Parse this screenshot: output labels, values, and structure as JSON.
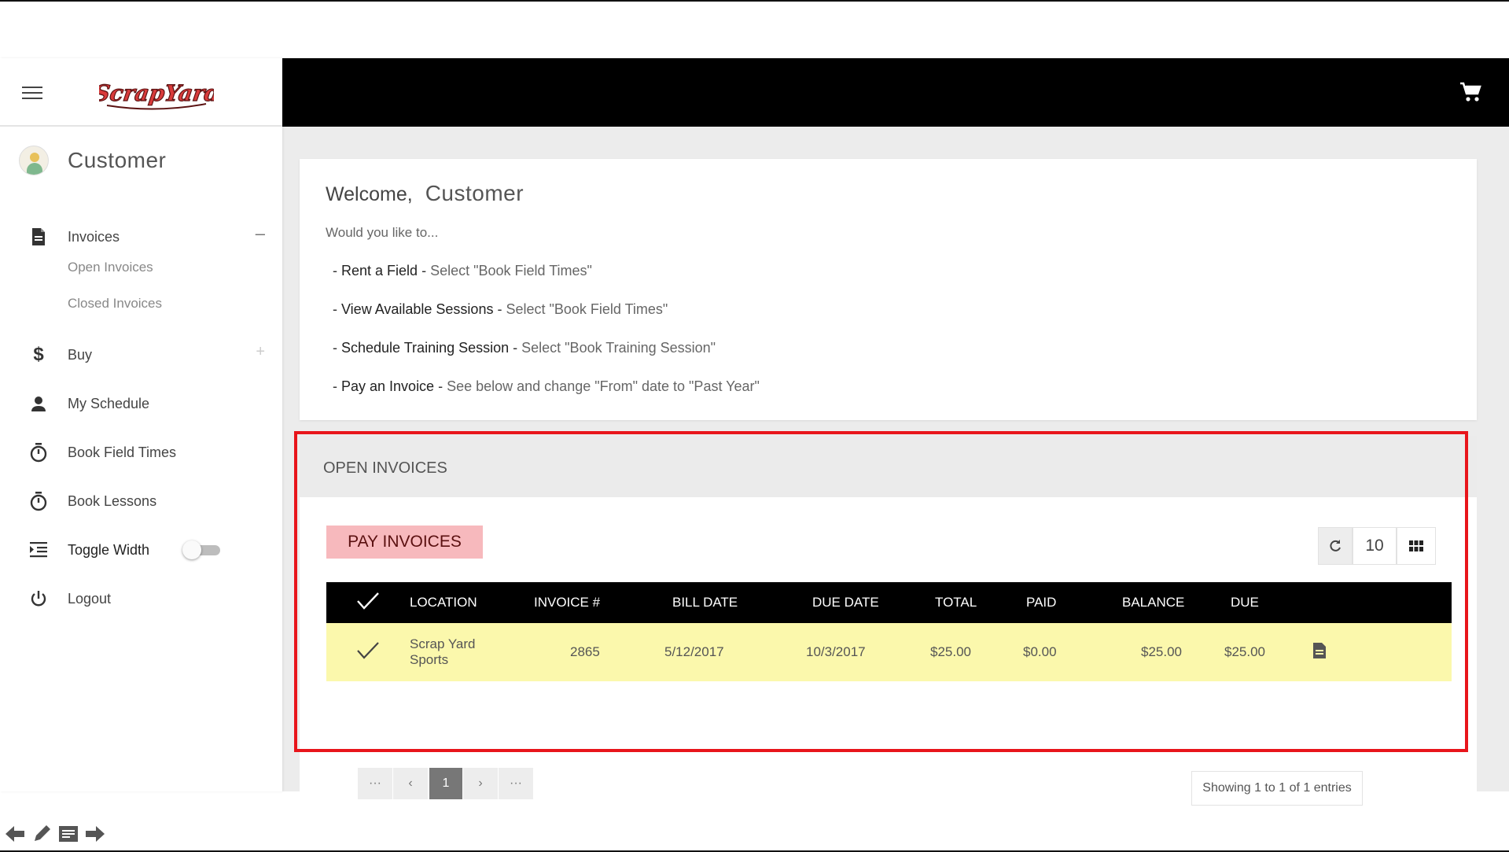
{
  "sidebar": {
    "logo_text": "ScrapYard",
    "user_name": "Customer",
    "items": [
      {
        "label": "Invoices",
        "icon": "document-icon",
        "state": "–"
      },
      {
        "label": "Open Invoices"
      },
      {
        "label": "Closed Invoices"
      },
      {
        "label": "Buy",
        "icon": "dollar-icon",
        "state": "+"
      },
      {
        "label": "My Schedule",
        "icon": "person-icon"
      },
      {
        "label": "Book Field Times",
        "icon": "timer-icon"
      },
      {
        "label": "Book Lessons",
        "icon": "timer-icon"
      },
      {
        "label": "Toggle Width",
        "icon": "indent-icon"
      },
      {
        "label": "Logout",
        "icon": "power-icon"
      }
    ]
  },
  "topbar": {
    "cart_icon": "cart-icon"
  },
  "welcome": {
    "greeting": "Welcome,",
    "name": "Customer",
    "question": "Would you like to...",
    "options": [
      {
        "title": "Rent a Field",
        "desc": "Select \"Book Field Times\""
      },
      {
        "title": "View Available Sessions",
        "desc": "Select \"Book Field Times\""
      },
      {
        "title": "Schedule Training Session",
        "desc": "Select \"Book Training Session\""
      },
      {
        "title": "Pay an Invoice",
        "desc": "See below and change \"From\" date to \"Past Year\""
      }
    ]
  },
  "invoices": {
    "section_title": "OPEN INVOICES",
    "pay_button": "PAY INVOICES",
    "page_size": "10",
    "columns": [
      "LOCATION",
      "INVOICE #",
      "BILL DATE",
      "DUE DATE",
      "TOTAL",
      "PAID",
      "BALANCE",
      "DUE"
    ],
    "rows": [
      {
        "location_line1": "Scrap Yard",
        "location_line2": "Sports",
        "invoice": "2865",
        "bill_date": "5/12/2017",
        "due_date": "10/3/2017",
        "total": "$25.00",
        "paid": "$0.00",
        "balance": "$25.00",
        "due": "$25.00"
      }
    ],
    "pager": {
      "first": "···",
      "prev": "‹",
      "current": "1",
      "next": "›",
      "last": "···"
    },
    "showing": "Showing 1 to 1 of 1 entries"
  },
  "colors": {
    "highlight": "#e8151b",
    "row_bg": "#fbf8ac",
    "pay_button_bg": "#f7b9bd",
    "header_bg": "#000000"
  }
}
